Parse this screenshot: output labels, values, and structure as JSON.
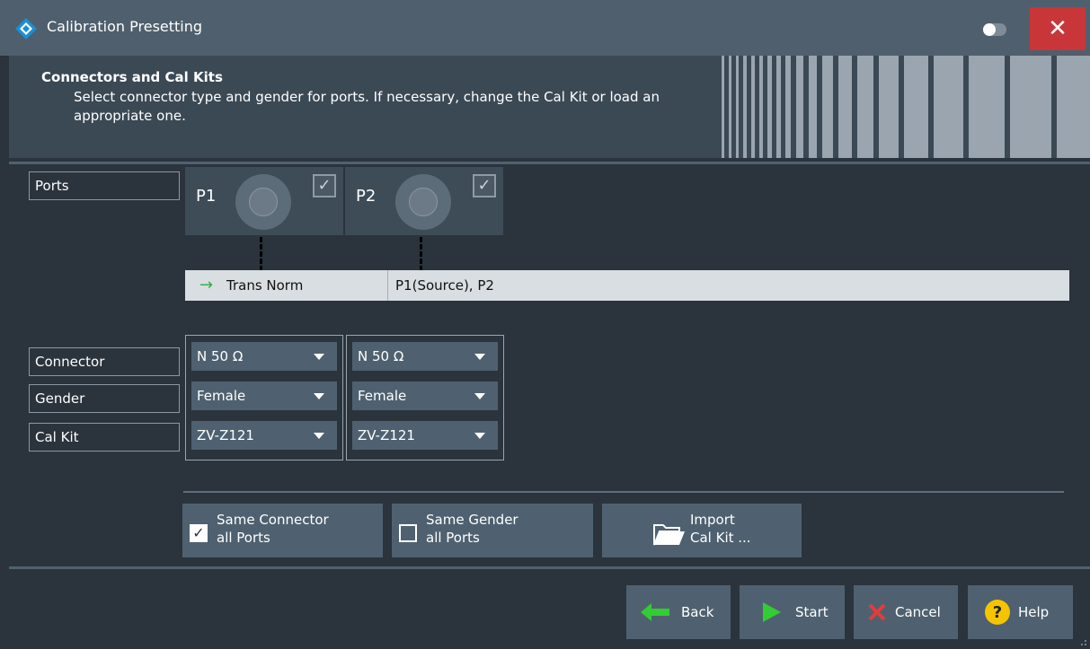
{
  "window": {
    "title": "Calibration Presetting",
    "close_glyph": "✕"
  },
  "header": {
    "title": "Connectors and Cal Kits",
    "description": "Select connector type and gender for ports. If necessary, change the Cal Kit or load an appropriate one."
  },
  "labels": {
    "ports": "Ports",
    "connector": "Connector",
    "gender": "Gender",
    "cal_kit": "Cal Kit"
  },
  "ports": [
    {
      "name": "P1",
      "checked": true,
      "connector": "N 50 Ω",
      "gender": "Female",
      "cal_kit": "ZV-Z121"
    },
    {
      "name": "P2",
      "checked": true,
      "connector": "N 50 Ω",
      "gender": "Female",
      "cal_kit": "ZV-Z121"
    }
  ],
  "calibration": {
    "type": "Trans Norm",
    "ports": "P1(Source), P2"
  },
  "options": {
    "same_connector": {
      "label_line1": "Same Connector",
      "label_line2": "all Ports",
      "checked": true
    },
    "same_gender": {
      "label_line1": "Same Gender",
      "label_line2": "all Ports",
      "checked": false
    },
    "import": {
      "label_line1": "Import",
      "label_line2": "Cal Kit ..."
    }
  },
  "footer": {
    "back": "Back",
    "start": "Start",
    "cancel": "Cancel",
    "help": "Help"
  },
  "colors": {
    "accent_close": "#c9363a",
    "arrow_green": "#2fb44a",
    "start_green": "#33cc33",
    "cancel_red": "#e53b3b",
    "help_yellow": "#f5c400"
  },
  "icons": [
    "rs-logo-icon",
    "toggle-icon",
    "close-icon",
    "connector-icon",
    "checkbox-icon",
    "arrow-right-icon",
    "dropdown-caret-icon",
    "folder-open-icon",
    "back-arrow-icon",
    "play-icon",
    "x-icon",
    "help-icon"
  ]
}
